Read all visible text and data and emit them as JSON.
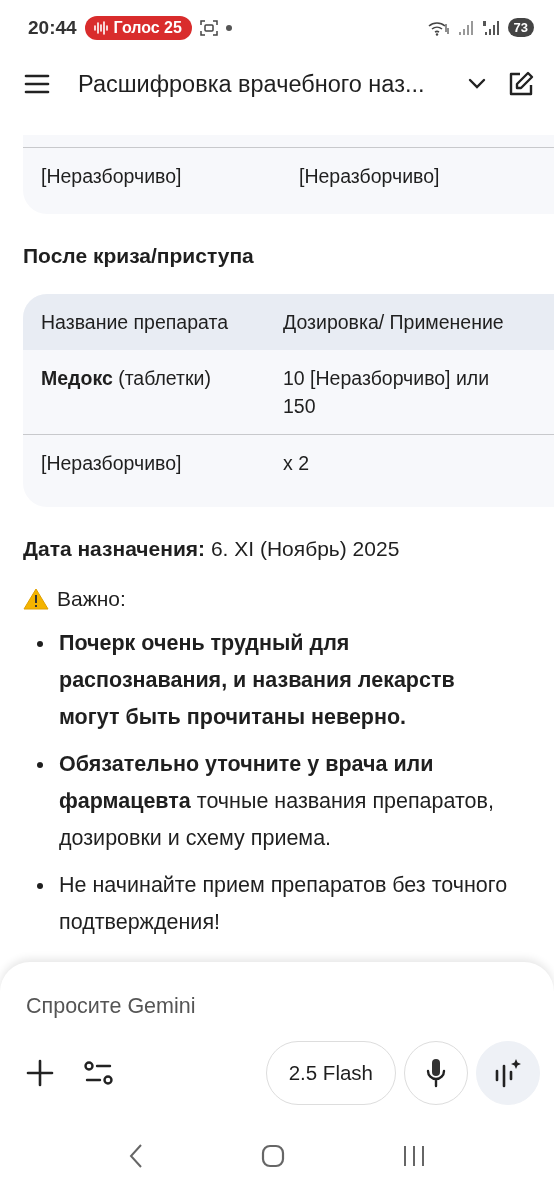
{
  "status_bar": {
    "time": "20:44",
    "recording_pill": "Голос 25",
    "battery": "73"
  },
  "header": {
    "title": "Расшифровка врачебного наз..."
  },
  "tables": [
    {
      "rows": [
        [
          "[Неразборчиво]",
          "[Неразборчиво]"
        ]
      ]
    },
    {
      "heading": "После криза/приступа",
      "columns": [
        "Название препарата",
        "Дозировка/ Применение"
      ],
      "rows": [
        [
          "**Медокс** (таблетки)",
          "10 [Неразборчиво] или 150"
        ],
        [
          "[Неразборчиво]",
          "x 2"
        ]
      ]
    }
  ],
  "date_line": "**Дата назначения:** 6. XI (Ноябрь) 2025",
  "warning": {
    "label": "Важно:",
    "bullets": [
      {
        "text": "Почерк очень трудный для распознавания, и названия лекарств могут быть прочитаны неверно.",
        "bold": true
      },
      {
        "text": "**Обязательно уточните у врача или фармацевта** точные названия препаратов, дозировки и схему приема.",
        "bold": false
      },
      {
        "text": "Не начинайте прием препаратов без точного подтверждения!",
        "bold": false
      }
    ]
  },
  "composer": {
    "placeholder": "Спросите Gemini",
    "model": "2.5 Flash"
  }
}
